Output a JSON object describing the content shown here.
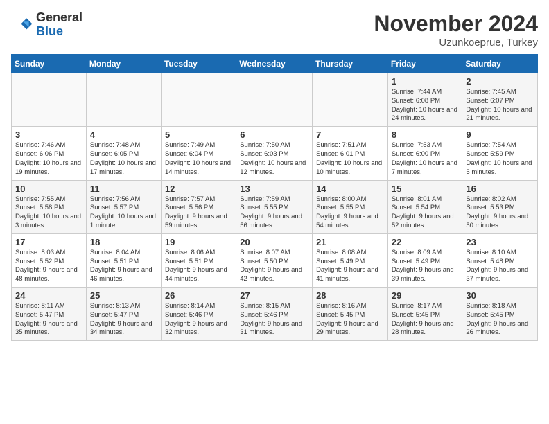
{
  "header": {
    "logo_line1": "General",
    "logo_line2": "Blue",
    "month": "November 2024",
    "location": "Uzunkoeprue, Turkey"
  },
  "weekdays": [
    "Sunday",
    "Monday",
    "Tuesday",
    "Wednesday",
    "Thursday",
    "Friday",
    "Saturday"
  ],
  "weeks": [
    [
      {
        "day": "",
        "info": ""
      },
      {
        "day": "",
        "info": ""
      },
      {
        "day": "",
        "info": ""
      },
      {
        "day": "",
        "info": ""
      },
      {
        "day": "",
        "info": ""
      },
      {
        "day": "1",
        "info": "Sunrise: 7:44 AM\nSunset: 6:08 PM\nDaylight: 10 hours and 24 minutes."
      },
      {
        "day": "2",
        "info": "Sunrise: 7:45 AM\nSunset: 6:07 PM\nDaylight: 10 hours and 21 minutes."
      }
    ],
    [
      {
        "day": "3",
        "info": "Sunrise: 7:46 AM\nSunset: 6:06 PM\nDaylight: 10 hours and 19 minutes."
      },
      {
        "day": "4",
        "info": "Sunrise: 7:48 AM\nSunset: 6:05 PM\nDaylight: 10 hours and 17 minutes."
      },
      {
        "day": "5",
        "info": "Sunrise: 7:49 AM\nSunset: 6:04 PM\nDaylight: 10 hours and 14 minutes."
      },
      {
        "day": "6",
        "info": "Sunrise: 7:50 AM\nSunset: 6:03 PM\nDaylight: 10 hours and 12 minutes."
      },
      {
        "day": "7",
        "info": "Sunrise: 7:51 AM\nSunset: 6:01 PM\nDaylight: 10 hours and 10 minutes."
      },
      {
        "day": "8",
        "info": "Sunrise: 7:53 AM\nSunset: 6:00 PM\nDaylight: 10 hours and 7 minutes."
      },
      {
        "day": "9",
        "info": "Sunrise: 7:54 AM\nSunset: 5:59 PM\nDaylight: 10 hours and 5 minutes."
      }
    ],
    [
      {
        "day": "10",
        "info": "Sunrise: 7:55 AM\nSunset: 5:58 PM\nDaylight: 10 hours and 3 minutes."
      },
      {
        "day": "11",
        "info": "Sunrise: 7:56 AM\nSunset: 5:57 PM\nDaylight: 10 hours and 1 minute."
      },
      {
        "day": "12",
        "info": "Sunrise: 7:57 AM\nSunset: 5:56 PM\nDaylight: 9 hours and 59 minutes."
      },
      {
        "day": "13",
        "info": "Sunrise: 7:59 AM\nSunset: 5:55 PM\nDaylight: 9 hours and 56 minutes."
      },
      {
        "day": "14",
        "info": "Sunrise: 8:00 AM\nSunset: 5:55 PM\nDaylight: 9 hours and 54 minutes."
      },
      {
        "day": "15",
        "info": "Sunrise: 8:01 AM\nSunset: 5:54 PM\nDaylight: 9 hours and 52 minutes."
      },
      {
        "day": "16",
        "info": "Sunrise: 8:02 AM\nSunset: 5:53 PM\nDaylight: 9 hours and 50 minutes."
      }
    ],
    [
      {
        "day": "17",
        "info": "Sunrise: 8:03 AM\nSunset: 5:52 PM\nDaylight: 9 hours and 48 minutes."
      },
      {
        "day": "18",
        "info": "Sunrise: 8:04 AM\nSunset: 5:51 PM\nDaylight: 9 hours and 46 minutes."
      },
      {
        "day": "19",
        "info": "Sunrise: 8:06 AM\nSunset: 5:51 PM\nDaylight: 9 hours and 44 minutes."
      },
      {
        "day": "20",
        "info": "Sunrise: 8:07 AM\nSunset: 5:50 PM\nDaylight: 9 hours and 42 minutes."
      },
      {
        "day": "21",
        "info": "Sunrise: 8:08 AM\nSunset: 5:49 PM\nDaylight: 9 hours and 41 minutes."
      },
      {
        "day": "22",
        "info": "Sunrise: 8:09 AM\nSunset: 5:49 PM\nDaylight: 9 hours and 39 minutes."
      },
      {
        "day": "23",
        "info": "Sunrise: 8:10 AM\nSunset: 5:48 PM\nDaylight: 9 hours and 37 minutes."
      }
    ],
    [
      {
        "day": "24",
        "info": "Sunrise: 8:11 AM\nSunset: 5:47 PM\nDaylight: 9 hours and 35 minutes."
      },
      {
        "day": "25",
        "info": "Sunrise: 8:13 AM\nSunset: 5:47 PM\nDaylight: 9 hours and 34 minutes."
      },
      {
        "day": "26",
        "info": "Sunrise: 8:14 AM\nSunset: 5:46 PM\nDaylight: 9 hours and 32 minutes."
      },
      {
        "day": "27",
        "info": "Sunrise: 8:15 AM\nSunset: 5:46 PM\nDaylight: 9 hours and 31 minutes."
      },
      {
        "day": "28",
        "info": "Sunrise: 8:16 AM\nSunset: 5:45 PM\nDaylight: 9 hours and 29 minutes."
      },
      {
        "day": "29",
        "info": "Sunrise: 8:17 AM\nSunset: 5:45 PM\nDaylight: 9 hours and 28 minutes."
      },
      {
        "day": "30",
        "info": "Sunrise: 8:18 AM\nSunset: 5:45 PM\nDaylight: 9 hours and 26 minutes."
      }
    ]
  ]
}
